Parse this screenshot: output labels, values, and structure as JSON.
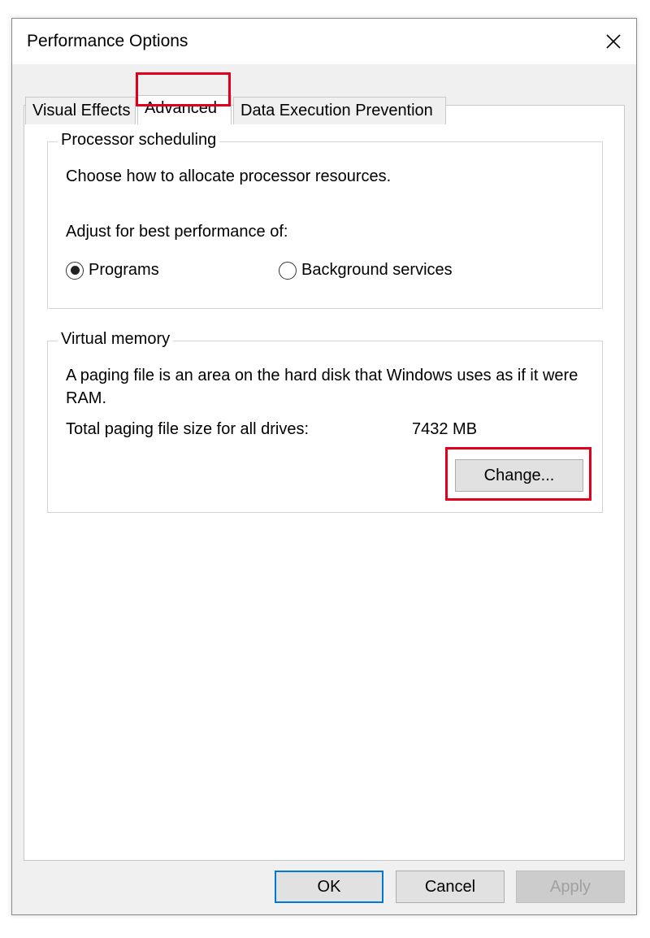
{
  "window": {
    "title": "Performance Options"
  },
  "tabs": [
    {
      "label": "Visual Effects",
      "selected": false
    },
    {
      "label": "Advanced",
      "selected": true
    },
    {
      "label": "Data Execution Prevention",
      "selected": false
    }
  ],
  "processor_scheduling": {
    "legend": "Processor scheduling",
    "description": "Choose how to allocate processor resources.",
    "adjust_label": "Adjust for best performance of:",
    "options": [
      {
        "label": "Programs",
        "selected": true
      },
      {
        "label": "Background services",
        "selected": false
      }
    ]
  },
  "virtual_memory": {
    "legend": "Virtual memory",
    "description": "A paging file is an area on the hard disk that Windows uses as if it were RAM.",
    "total_label": "Total paging file size for all drives:",
    "total_value": "7432 MB",
    "change_label": "Change..."
  },
  "footer": {
    "ok_label": "OK",
    "cancel_label": "Cancel",
    "apply_label": "Apply"
  },
  "colors": {
    "highlight": "#e0001b",
    "default_button_border": "#0078d7"
  },
  "icons": {
    "close": "close-icon"
  }
}
